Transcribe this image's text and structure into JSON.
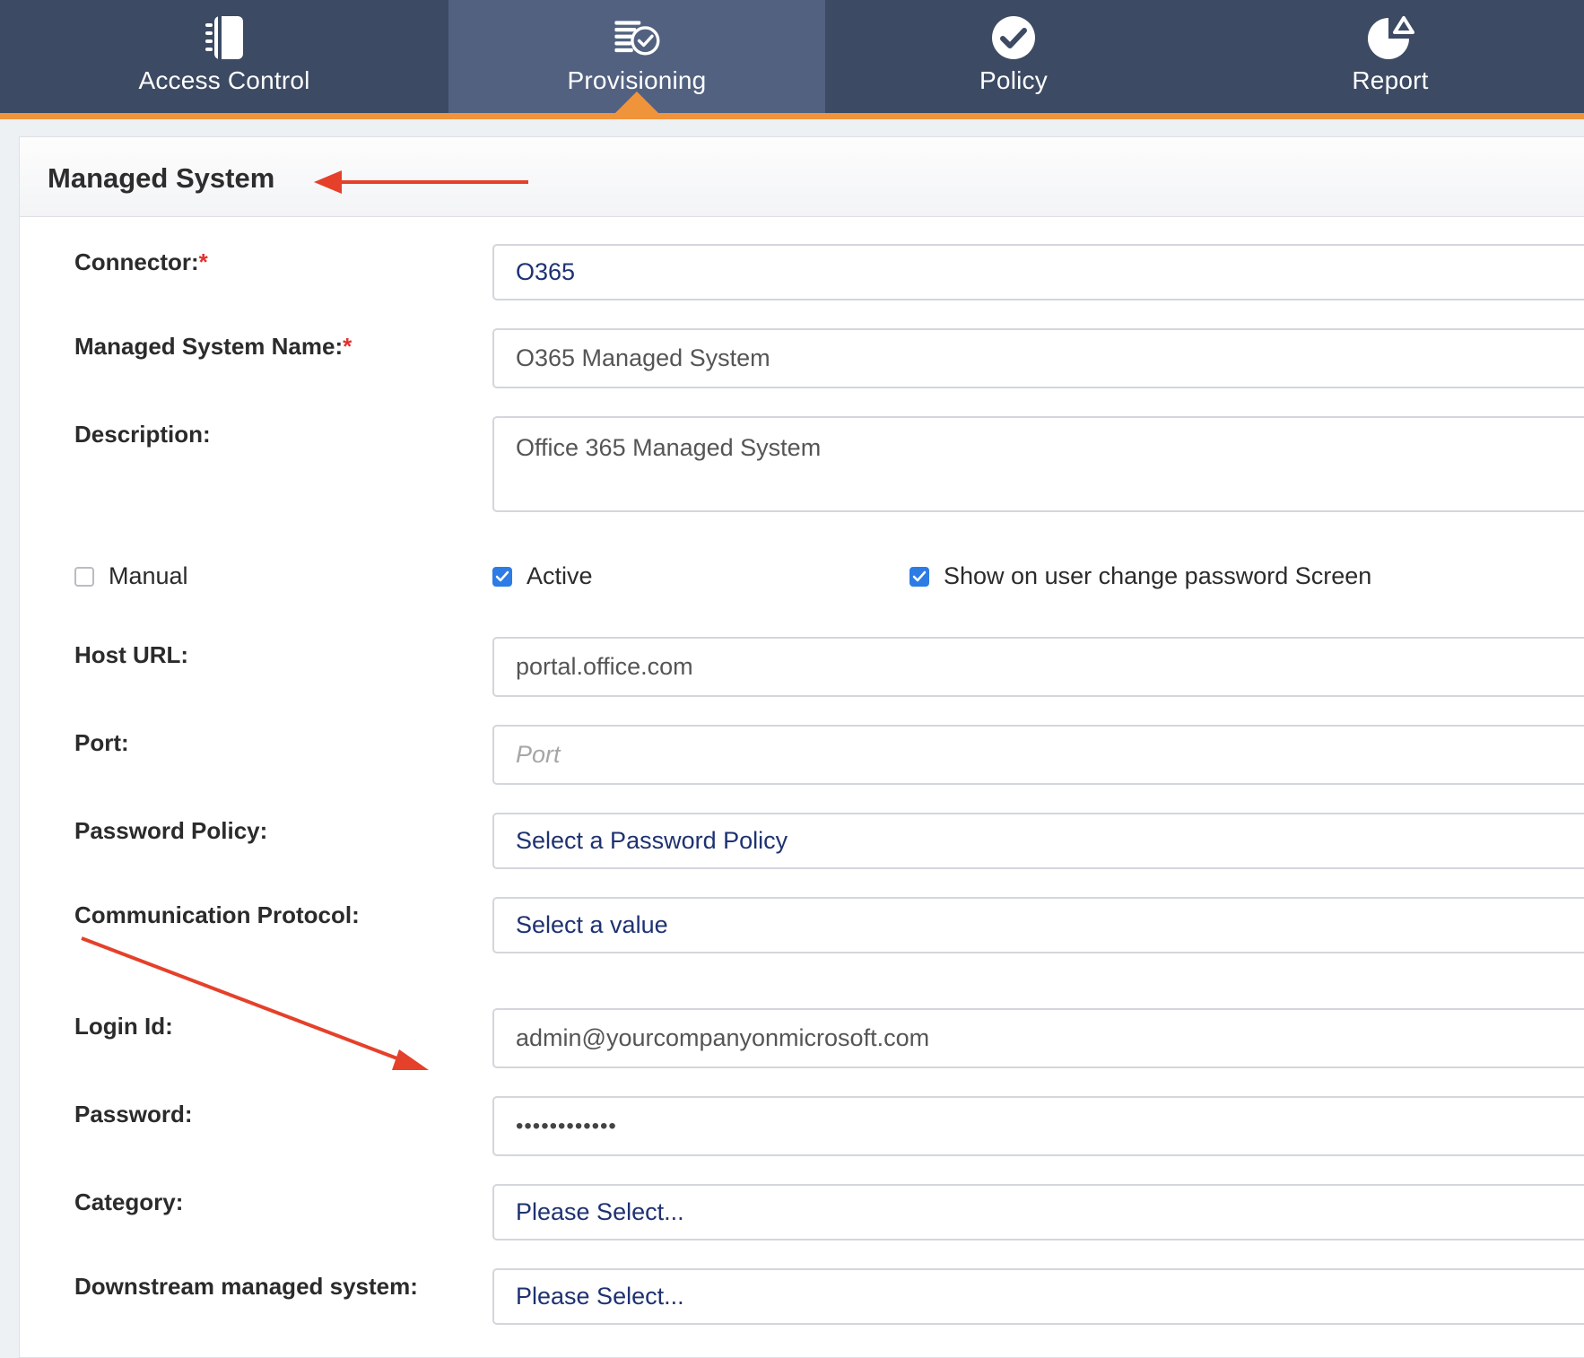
{
  "nav": {
    "tabs": [
      {
        "label": "Access Control",
        "icon": "notebook-icon"
      },
      {
        "label": "Provisioning",
        "icon": "provisioning-list-icon"
      },
      {
        "label": "Policy",
        "icon": "checkmark-circle-icon"
      },
      {
        "label": "Report",
        "icon": "pie-chart-icon"
      }
    ],
    "active_tab": "Provisioning",
    "colors": {
      "bar": "#3c4a63",
      "active": "#526180",
      "accent": "#f0943c"
    }
  },
  "panel": {
    "title": "Managed System"
  },
  "form": {
    "connector": {
      "label": "Connector:",
      "required": "*",
      "value": "O365"
    },
    "managed_system_name": {
      "label": "Managed System Name:",
      "required": "*",
      "value": "O365 Managed System"
    },
    "description": {
      "label": "Description:",
      "value": "Office 365 Managed System"
    },
    "checkboxes": {
      "manual": {
        "label": "Manual",
        "checked": false
      },
      "active": {
        "label": "Active",
        "checked": true
      },
      "show_on_change_password": {
        "label": "Show on user change password Screen",
        "checked": true
      }
    },
    "host_url": {
      "label": "Host URL:",
      "value": "portal.office.com"
    },
    "port": {
      "label": "Port:",
      "placeholder": "Port",
      "value": ""
    },
    "password_policy": {
      "label": "Password Policy:",
      "value": "Select a Password Policy"
    },
    "communication_protocol": {
      "label": "Communication Protocol:",
      "value": "Select a value"
    },
    "login_id": {
      "label": "Login Id:",
      "value": "admin@yourcompanyonmicrosoft.com"
    },
    "password": {
      "label": "Password:",
      "value": "••••••••••••"
    },
    "category": {
      "label": "Category:",
      "value": "Please Select..."
    },
    "downstream_managed_system": {
      "label": "Downstream managed system:",
      "value": "Please Select..."
    }
  },
  "annotation_color": "#e5402a"
}
